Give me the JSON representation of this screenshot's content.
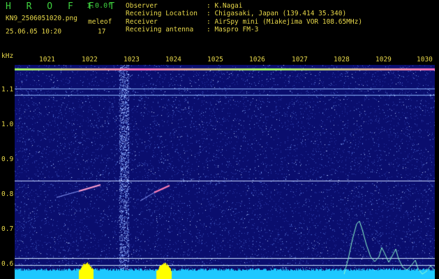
{
  "header": {
    "title": "H R O F F T",
    "version": "1.0.0f",
    "filename": "KN9_2506051020.png",
    "meleof_label": "meleof",
    "date": "25.06.05 10:20",
    "meteor_count": "17"
  },
  "info": [
    {
      "label": "Observer",
      "value": ": K.Nagai"
    },
    {
      "label": "Receiving Location",
      "value": ": Chigasaki, Japan (139.414 35.340)"
    },
    {
      "label": "Receiver",
      "value": ": AirSpy mini (Miakejima VOR 108.65MHz)"
    },
    {
      "label": "Receiving antenna",
      "value": ": Maspro FM-3"
    }
  ],
  "axis": {
    "y_unit": "kHz",
    "y_ticks": [
      "1.1",
      "1.0",
      "0.9",
      "0.8",
      "0.7",
      "0.6"
    ],
    "x_ticks": [
      "1021",
      "1022",
      "1023",
      "1024",
      "1025",
      "1026",
      "1027",
      "1028",
      "1029",
      "1030"
    ]
  },
  "colors": {
    "text": "#e8d84a",
    "title": "#3fd23f",
    "background": "#0a0e6e",
    "trace": "#90ffd0",
    "baseline": "#1ec8ff",
    "peak": "#ffff00"
  }
}
